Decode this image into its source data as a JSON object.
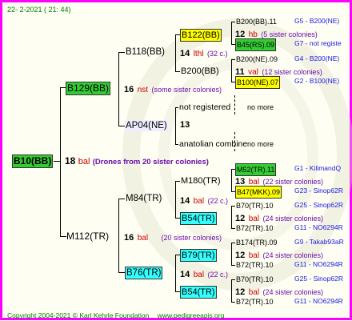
{
  "header": {
    "date": "22-  2-2021  (  21: 44)"
  },
  "footer": {
    "copyright": "Copyright 2004-2021 © Karl Kehrle Foundation",
    "url": "www.pedigreeapis.org"
  },
  "root": {
    "id": "B10(BB)",
    "gen": "18",
    "breed": "bal",
    "note": "(Drones from 20 sister colonies)"
  },
  "queen_line": {
    "q1": {
      "id": "B129(BB)",
      "gen": "16",
      "breed": "nst",
      "note": "(some sister colonies)"
    },
    "q2": {
      "id": "B118(BB)"
    },
    "q3": {
      "id": "B122(BB)",
      "gen": "14",
      "breed": "lthl",
      "note": "(32 c.)"
    },
    "q4a": {
      "id": "B200(BB).11",
      "right": "G5 - B200(NE)"
    },
    "q4b": {
      "gen": "12",
      "breed": "hb",
      "note": "(5 sister colonies)"
    },
    "q4c": {
      "id": "B45(RS).09",
      "right": "G7 - not registe"
    },
    "q5": {
      "id": "B200(BB)"
    },
    "q5a": {
      "id": "B200(NE).09",
      "right": "G4 - B200(NE)"
    },
    "q5b": {
      "gen": "11",
      "breed": "val",
      "note": "(12 sister colonies)"
    },
    "q5c": {
      "id": "B100(NE).07",
      "right": "G2 - B100(NE)"
    },
    "q6": {
      "id": "AP04(NE)",
      "gen": "13"
    },
    "q6a": {
      "id": "not registered",
      "right": "no more"
    },
    "q6b": {
      "id": "anatolian combine",
      "right": "no more"
    }
  },
  "drone_line": {
    "d1": {
      "id": "M112(TR)",
      "gen": "16",
      "breed": "bal",
      "note": "(20 sister colonies)"
    },
    "d2": {
      "id": "M84(TR)",
      "gen": "14",
      "breed": "bal",
      "note": "(22 c.)"
    },
    "d3": {
      "id": "M180(TR)"
    },
    "d3a": {
      "id": "M52(TR).11",
      "right": "G1 - KilimandQ"
    },
    "d3b": {
      "gen": "13",
      "breed": "bal",
      "note": "(22 sister colonies)"
    },
    "d3c": {
      "id": "B47(MKK).09",
      "right": "G23 - Sinop62R"
    },
    "d4": {
      "id": "B54(TR)"
    },
    "d4a": {
      "id": "B70(TR).10",
      "right": "G25 - Sinop62R"
    },
    "d4b": {
      "gen": "12",
      "breed": "bal",
      "note": "(24 sister colonies)"
    },
    "d4c": {
      "id": "B72(TR).10",
      "right": "G11 - NO6294R"
    },
    "d5": {
      "id": "B76(TR)",
      "gen": "14",
      "breed": "bal",
      "note": "(22 c.)"
    },
    "d6": {
      "id": "B79(TR)"
    },
    "d6a": {
      "id": "B174(TR).09",
      "right": "G9 - Takab93aR"
    },
    "d6b": {
      "gen": "12",
      "breed": "bal",
      "note": "(24 sister colonies)"
    },
    "d6c": {
      "id": "B72(TR).10",
      "right": "G11 - NO6294R"
    },
    "d7": {
      "id": "B54(TR)"
    },
    "d7a": {
      "id": "B70(TR).10",
      "right": "G25 - Sinop62R"
    },
    "d7b": {
      "gen": "12",
      "breed": "bal",
      "note": "(24 sister colonies)"
    },
    "d7c": {
      "id": "B72(TR).10",
      "right": "G11 - NO6294R"
    }
  }
}
